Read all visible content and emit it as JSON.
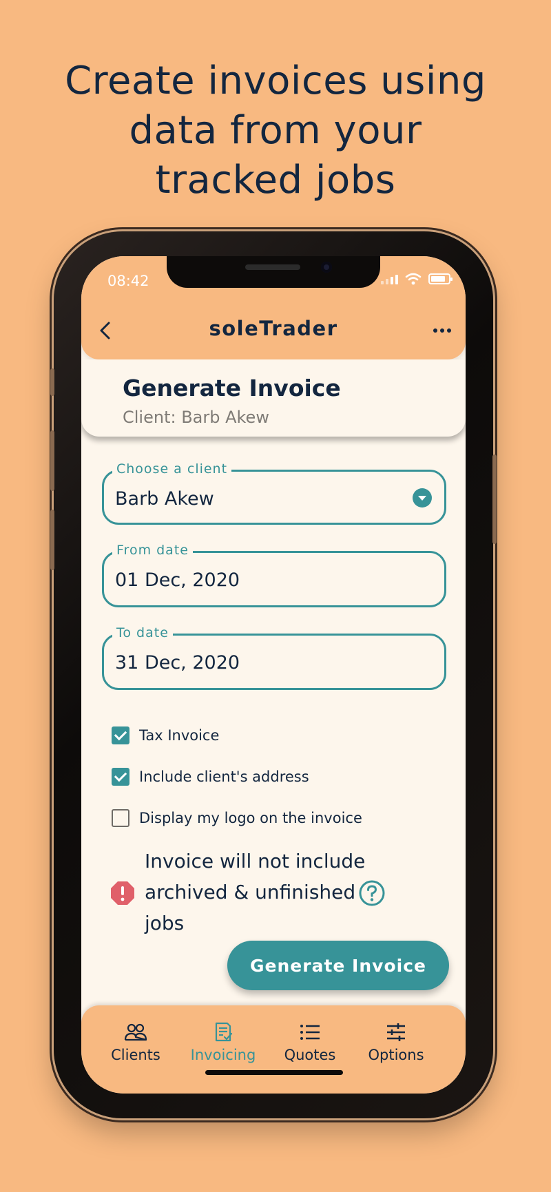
{
  "headline": {
    "line1": "Create invoices using",
    "line2": "data from your",
    "line3": "tracked jobs"
  },
  "status_bar": {
    "time": "08:42"
  },
  "app_bar": {
    "title": "soleTrader",
    "back_icon": "chevron-left-icon",
    "more_icon": "more-horizontal-icon"
  },
  "header": {
    "title": "Generate Invoice",
    "subtitle": "Client: Barb Akew"
  },
  "form": {
    "client": {
      "label": "Choose a client",
      "value": "Barb Akew"
    },
    "from_date": {
      "label": "From date",
      "value": "01 Dec, 2020"
    },
    "to_date": {
      "label": "To date",
      "value": "31 Dec, 2020"
    },
    "options": [
      {
        "label": "Tax Invoice",
        "checked": true
      },
      {
        "label": "Include client's address",
        "checked": true
      },
      {
        "label": "Display my logo on the invoice",
        "checked": false
      }
    ],
    "warning": "Invoice will not include archived & unfinished jobs",
    "submit_label": "Generate Invoice"
  },
  "tabs": [
    {
      "label": "Clients",
      "icon": "people-icon",
      "active": false
    },
    {
      "label": "Invoicing",
      "icon": "invoice-icon",
      "active": true
    },
    {
      "label": "Quotes",
      "icon": "list-icon",
      "active": false
    },
    {
      "label": "Options",
      "icon": "sliders-icon",
      "active": false
    }
  ],
  "colors": {
    "background": "#f8b981",
    "accent": "#379398",
    "text": "#13263f",
    "screen": "#fdf6ec",
    "warning": "#e0606a"
  }
}
